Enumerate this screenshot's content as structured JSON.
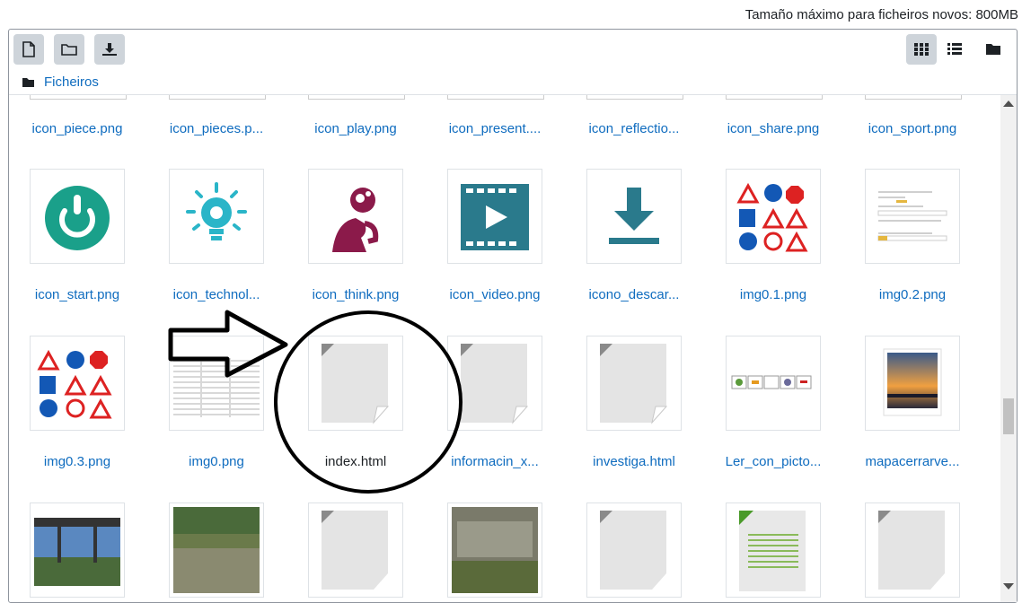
{
  "header": {
    "max_size_text": "Tamaño máximo para ficheiros novos: 800MB"
  },
  "toolbar": {
    "buttons_left": [
      "add-file-icon",
      "create-folder-icon",
      "download-icon"
    ],
    "buttons_right": [
      "grid-view-icon",
      "list-view-icon",
      "tree-view-icon"
    ]
  },
  "breadcrumb": {
    "folder_label": "Ficheiros"
  },
  "rows": [
    {
      "names": [
        "icon_piece.png",
        "icon_pieces.p...",
        "icon_play.png",
        "icon_present....",
        "icon_reflectio...",
        "icon_share.png",
        "icon_sport.png"
      ]
    },
    {
      "names": [
        "icon_start.png",
        "icon_technol...",
        "icon_think.png",
        "icon_video.png",
        "icono_descar...",
        "img0.1.png",
        "img0.2.png"
      ]
    },
    {
      "names": [
        "img0.3.png",
        "img0.png",
        "index.html",
        "informacin_x...",
        "investiga.html",
        "Ler_con_picto...",
        "mapacerrarve..."
      ]
    }
  ],
  "colors": {
    "link": "#0f6cbf",
    "teal": "#00a0a0",
    "plum": "#8b1a4a",
    "petrol": "#2a7a8c"
  }
}
